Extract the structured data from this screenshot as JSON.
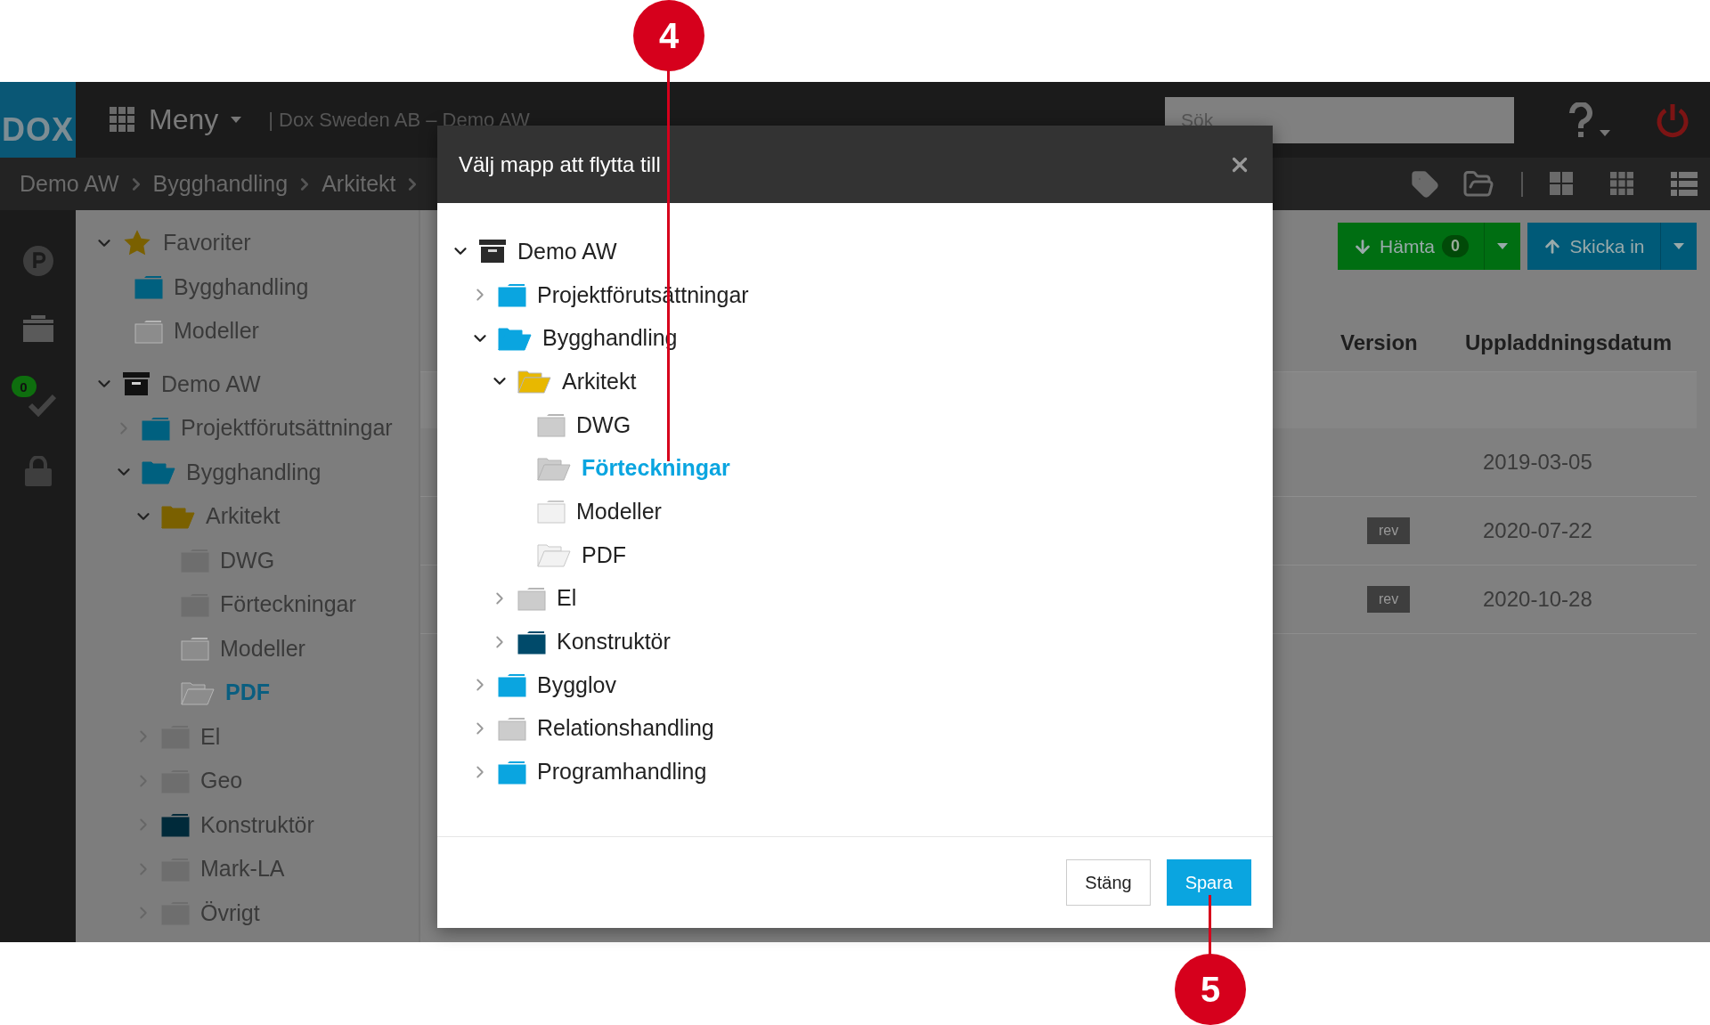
{
  "annotations": [
    {
      "number": "4"
    },
    {
      "number": "5"
    }
  ],
  "topbar": {
    "logo": "DOX",
    "menu": "Meny",
    "company": "| Dox Sweden AB – Demo AW",
    "search": {
      "placeholder": "Sök"
    }
  },
  "breadcrumb": [
    "Demo AW",
    "Bygghandling",
    "Arkitekt"
  ],
  "rail": {
    "tasks_badge": "0"
  },
  "sidebar": {
    "favorites": {
      "label": "Favoriter",
      "expanded": true,
      "children": [
        {
          "label": "Bygghandling",
          "kind": "folder",
          "color": "#00607f",
          "selected": false
        },
        {
          "label": "Modeller",
          "kind": "folder",
          "color": "#8c8c8c",
          "selected": false
        }
      ]
    },
    "tree": [
      {
        "label": "Demo AW",
        "kind": "archive",
        "color": "#111111",
        "expanded": true,
        "selected": false,
        "children": [
          {
            "label": "Projektförutsättningar",
            "kind": "folder",
            "color": "#00607f",
            "expanded": false,
            "selected": false
          },
          {
            "label": "Bygghandling",
            "kind": "open-folder",
            "color": "#00607f",
            "expanded": true,
            "selected": false,
            "children": [
              {
                "label": "Arkitekt",
                "kind": "open-folder",
                "color": "#7a6000",
                "expanded": true,
                "selected": false,
                "children": [
                  {
                    "label": "DWG",
                    "kind": "folder",
                    "color": "#6e6e6e",
                    "selected": false
                  },
                  {
                    "label": "Förteckningar",
                    "kind": "folder",
                    "color": "#6e6e6e",
                    "selected": false
                  },
                  {
                    "label": "Modeller",
                    "kind": "folder",
                    "color": "#8c8c8c",
                    "selected": false
                  },
                  {
                    "label": "PDF",
                    "kind": "open-folder",
                    "color": "#8c8c8c",
                    "selected": true
                  }
                ]
              },
              {
                "label": "El",
                "kind": "folder",
                "color": "#6e6e6e",
                "expanded": false,
                "selected": false
              },
              {
                "label": "Geo",
                "kind": "folder",
                "color": "#6e6e6e",
                "expanded": false,
                "selected": false
              },
              {
                "label": "Konstruktör",
                "kind": "folder",
                "color": "#002a3a",
                "expanded": false,
                "selected": false
              },
              {
                "label": "Mark-LA",
                "kind": "folder",
                "color": "#6e6e6e",
                "expanded": false,
                "selected": false
              },
              {
                "label": "Övrigt",
                "kind": "folder",
                "color": "#6e6e6e",
                "expanded": false,
                "selected": false
              }
            ]
          }
        ]
      }
    ]
  },
  "content": {
    "download": {
      "label": "Hämta",
      "count": "0"
    },
    "upload": {
      "label": "Skicka in"
    },
    "columns": [
      "Version",
      "Uppladdningsdatum"
    ],
    "rows": [
      {
        "selected": true
      },
      {
        "selected": false,
        "date": "2019-03-05"
      },
      {
        "selected": false,
        "version": "rev",
        "date": "2020-07-22"
      },
      {
        "selected": false,
        "version": "rev",
        "date": "2020-10-28"
      }
    ]
  },
  "dialog": {
    "title": "Välj mapp att flytta till",
    "tree": [
      {
        "label": "Demo AW",
        "kind": "archive",
        "color": "#2a2a2a",
        "expanded": true,
        "selected": false,
        "children": [
          {
            "label": "Projektförutsättningar",
            "kind": "folder",
            "color": "#0aa5e0",
            "expanded": false,
            "selected": false
          },
          {
            "label": "Bygghandling",
            "kind": "open-folder",
            "color": "#0aa5e0",
            "expanded": true,
            "selected": false,
            "children": [
              {
                "label": "Arkitekt",
                "kind": "open-folder",
                "color": "#e8b800",
                "expanded": true,
                "selected": false,
                "children": [
                  {
                    "label": "DWG",
                    "kind": "folder",
                    "color": "#cccccc",
                    "selected": false
                  },
                  {
                    "label": "Förteckningar",
                    "kind": "open-folder",
                    "color": "#cccccc",
                    "selected": true
                  },
                  {
                    "label": "Modeller",
                    "kind": "folder",
                    "color": "#f2f2f2",
                    "selected": false
                  },
                  {
                    "label": "PDF",
                    "kind": "open-folder",
                    "color": "#f2f2f2",
                    "selected": false
                  }
                ]
              },
              {
                "label": "El",
                "kind": "folder",
                "color": "#cccccc",
                "expanded": false,
                "selected": false
              },
              {
                "label": "Konstruktör",
                "kind": "folder",
                "color": "#004a6a",
                "expanded": false,
                "selected": false
              }
            ]
          },
          {
            "label": "Bygglov",
            "kind": "folder",
            "color": "#0aa5e0",
            "expanded": false,
            "selected": false
          },
          {
            "label": "Relationshandling",
            "kind": "folder",
            "color": "#cccccc",
            "expanded": false,
            "selected": false
          },
          {
            "label": "Programhandling",
            "kind": "folder",
            "color": "#0aa5e0",
            "expanded": false,
            "selected": false
          }
        ]
      }
    ],
    "buttons": [
      {
        "label": "Stäng",
        "kind": "secondary"
      },
      {
        "label": "Spara",
        "kind": "primary"
      }
    ]
  }
}
